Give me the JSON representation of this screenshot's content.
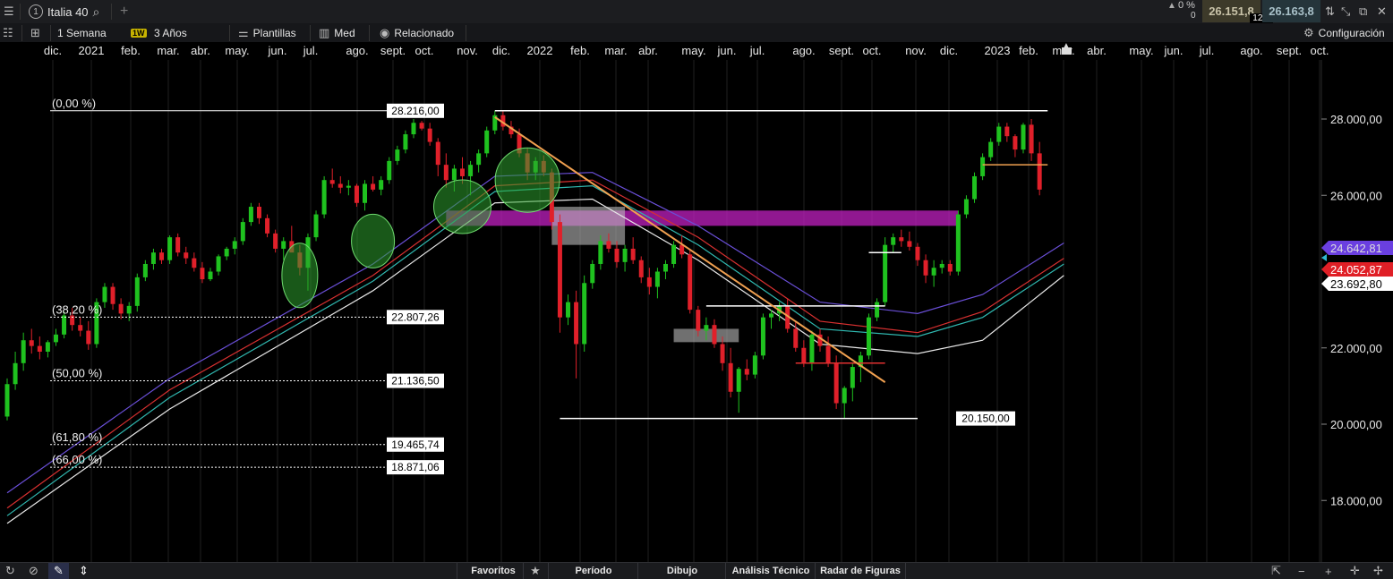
{
  "toolbar": {
    "instrument": "Italia 40",
    "change_pct": "0 %",
    "change_count": "0",
    "bid": "26.151,8",
    "spread": "12,0",
    "ask": "26.163,8"
  },
  "chart_toolbar": {
    "interval": "1 Semana",
    "interval_badge": "1W",
    "range": "3 Años",
    "templates": "Plantillas",
    "average": "Med",
    "related": "Relacionado",
    "settings": "Configuración"
  },
  "months": [
    "dic.",
    "2021",
    "feb.",
    "mar.",
    "abr.",
    "may.",
    "jun.",
    "jul.",
    "ago.",
    "sept.",
    "oct.",
    "nov.",
    "dic.",
    "2022",
    "feb.",
    "mar.",
    "abr.",
    "may.",
    "jun.",
    "jul.",
    "ago.",
    "sept.",
    "oct.",
    "nov.",
    "dic.",
    "2023",
    "feb.",
    "mar.",
    "abr.",
    "may.",
    "jun.",
    "jul.",
    "ago.",
    "sept.",
    "oct."
  ],
  "price_axis": [
    "28.000,00",
    "26.000,00",
    "22.000,00",
    "20.000,00",
    "18.000,00"
  ],
  "price_tags": {
    "purple": "24.642,81",
    "red": "24.052,87",
    "white": "23.692,80"
  },
  "fib_levels": [
    {
      "pct": "(0,00 %)",
      "value": "28.216,00"
    },
    {
      "pct": "(38,20 %)",
      "value": "22.807,26"
    },
    {
      "pct": "(50,00 %)",
      "value": "21.136,50"
    },
    {
      "pct": "(61,80 %)",
      "value": "19.465,74"
    },
    {
      "pct": "(66,00 %)",
      "value": "18.871,06"
    }
  ],
  "low_label": "20.150,00",
  "bottom_tabs": {
    "favorites": "Favoritos",
    "period": "Período",
    "drawing": "Dibujo",
    "technical": "Análisis Técnico",
    "patterns": "Radar de Figuras"
  },
  "colors": {
    "up": "#1fc21f",
    "down": "#e0202a",
    "fib_line": "#ffffff",
    "trendline": "#f0a050",
    "zone": "#c020c0",
    "ma_purple": "#6a4fd8",
    "ma_red": "#d83030",
    "ma_teal": "#2fb8b0",
    "ma_white": "#e8e8e8"
  },
  "chart_data": {
    "type": "candlestick",
    "title": "Italia 40",
    "interval": "1 Semana",
    "range": "3 Años",
    "ylim": [
      16500,
      29800
    ],
    "y_ticks": [
      28000,
      26000,
      22000,
      20000,
      18000
    ],
    "candles": [
      [
        20200,
        21200,
        20100,
        21050
      ],
      [
        21050,
        21900,
        20900,
        21600
      ],
      [
        21600,
        22400,
        21400,
        22200
      ],
      [
        22200,
        22500,
        21850,
        22050
      ],
      [
        22050,
        22300,
        21700,
        21900
      ],
      [
        21900,
        22200,
        21750,
        22150
      ],
      [
        22150,
        22500,
        22050,
        22350
      ],
      [
        22350,
        22950,
        22250,
        22850
      ],
      [
        22850,
        23050,
        22450,
        22600
      ],
      [
        22600,
        22800,
        22300,
        22450
      ],
      [
        22450,
        22700,
        21950,
        22100
      ],
      [
        22100,
        23300,
        22000,
        23200
      ],
      [
        23200,
        23700,
        23050,
        23600
      ],
      [
        23600,
        23700,
        23000,
        23150
      ],
      [
        23150,
        23300,
        22750,
        22900
      ],
      [
        22900,
        23200,
        22700,
        23100
      ],
      [
        23100,
        23950,
        22950,
        23850
      ],
      [
        23850,
        24300,
        23750,
        24200
      ],
      [
        24200,
        24600,
        24050,
        24500
      ],
      [
        24500,
        24600,
        24200,
        24300
      ],
      [
        24300,
        24950,
        24200,
        24900
      ],
      [
        24900,
        25000,
        24400,
        24500
      ],
      [
        24500,
        24650,
        24200,
        24350
      ],
      [
        24350,
        24500,
        24000,
        24100
      ],
      [
        24100,
        24250,
        23700,
        23800
      ],
      [
        23800,
        24100,
        23750,
        24000
      ],
      [
        24000,
        24450,
        23900,
        24400
      ],
      [
        24400,
        24650,
        24300,
        24600
      ],
      [
        24600,
        24900,
        24450,
        24800
      ],
      [
        24800,
        25400,
        24700,
        25300
      ],
      [
        25300,
        25800,
        25200,
        25700
      ],
      [
        25700,
        25800,
        25250,
        25400
      ],
      [
        25400,
        25500,
        24900,
        25000
      ],
      [
        25000,
        25100,
        24500,
        24600
      ],
      [
        24600,
        24900,
        24300,
        24800
      ],
      [
        24800,
        25200,
        24600,
        24500
      ],
      [
        24500,
        24700,
        23900,
        24100
      ],
      [
        24100,
        25000,
        23500,
        24900
      ],
      [
        24900,
        25600,
        24800,
        25500
      ],
      [
        25500,
        26500,
        25400,
        26400
      ],
      [
        26400,
        26700,
        26200,
        26300
      ],
      [
        26300,
        26500,
        26050,
        26200
      ],
      [
        26200,
        26400,
        26000,
        26250
      ],
      [
        26250,
        26300,
        25700,
        25800
      ],
      [
        25800,
        26400,
        25600,
        26300
      ],
      [
        26300,
        26500,
        26100,
        26150
      ],
      [
        26150,
        26500,
        26000,
        26400
      ],
      [
        26400,
        27000,
        26300,
        26900
      ],
      [
        26900,
        27300,
        26800,
        27200
      ],
      [
        27200,
        27700,
        27100,
        27600
      ],
      [
        27600,
        28000,
        27500,
        27900
      ],
      [
        27900,
        27950,
        27700,
        27750
      ],
      [
        27750,
        27900,
        27300,
        27400
      ],
      [
        27400,
        27500,
        26500,
        26800
      ],
      [
        26800,
        27100,
        26200,
        26400
      ],
      [
        26400,
        26800,
        26100,
        26700
      ],
      [
        26700,
        27000,
        26300,
        26500
      ],
      [
        26500,
        26900,
        26000,
        26800
      ],
      [
        26800,
        27200,
        26600,
        27100
      ],
      [
        27100,
        27800,
        27000,
        27700
      ],
      [
        27700,
        28216,
        27600,
        28100
      ],
      [
        28100,
        28200,
        27700,
        27800
      ],
      [
        27800,
        27950,
        27500,
        27600
      ],
      [
        27600,
        27750,
        27000,
        27100
      ],
      [
        27100,
        27250,
        26400,
        26600
      ],
      [
        26600,
        27000,
        26400,
        26900
      ],
      [
        26900,
        27050,
        26500,
        26600
      ],
      [
        26600,
        26700,
        25100,
        25300
      ],
      [
        25300,
        25500,
        22400,
        22800
      ],
      [
        22800,
        23400,
        22600,
        23200
      ],
      [
        23200,
        23500,
        21200,
        22100
      ],
      [
        22100,
        23900,
        21900,
        23700
      ],
      [
        23700,
        24300,
        23550,
        24200
      ],
      [
        24200,
        24950,
        24050,
        24800
      ],
      [
        24800,
        25000,
        24500,
        24600
      ],
      [
        24600,
        24800,
        24100,
        24250
      ],
      [
        24250,
        24700,
        24000,
        24600
      ],
      [
        24600,
        24900,
        24200,
        24300
      ],
      [
        24300,
        24400,
        23700,
        23850
      ],
      [
        23850,
        24100,
        23400,
        23600
      ],
      [
        23600,
        24100,
        23300,
        24000
      ],
      [
        24000,
        24300,
        23800,
        24200
      ],
      [
        24200,
        24800,
        24100,
        24700
      ],
      [
        24700,
        24950,
        24350,
        24450
      ],
      [
        24450,
        24550,
        22900,
        23000
      ],
      [
        23000,
        23100,
        22300,
        22450
      ],
      [
        22450,
        22800,
        22200,
        22600
      ],
      [
        22600,
        22750,
        22000,
        22100
      ],
      [
        22100,
        22300,
        21400,
        21600
      ],
      [
        21600,
        22000,
        20700,
        20850
      ],
      [
        20850,
        21500,
        20300,
        21450
      ],
      [
        21450,
        21700,
        21150,
        21300
      ],
      [
        21300,
        21900,
        21200,
        21800
      ],
      [
        21800,
        22900,
        21700,
        22800
      ],
      [
        22800,
        23000,
        22500,
        22900
      ],
      [
        22900,
        23200,
        22700,
        23100
      ],
      [
        23100,
        23300,
        22400,
        22500
      ],
      [
        22500,
        22700,
        21900,
        22000
      ],
      [
        22000,
        22200,
        21500,
        21600
      ],
      [
        21600,
        22450,
        21400,
        22350
      ],
      [
        22350,
        22500,
        21900,
        22050
      ],
      [
        22050,
        22300,
        21500,
        21600
      ],
      [
        21600,
        21800,
        20400,
        20550
      ],
      [
        20550,
        21000,
        20150,
        20950
      ],
      [
        20950,
        21600,
        20600,
        21500
      ],
      [
        21500,
        21900,
        21100,
        21800
      ],
      [
        21800,
        22900,
        21700,
        22800
      ],
      [
        22800,
        23300,
        22700,
        23200
      ],
      [
        23200,
        24900,
        23100,
        24700
      ],
      [
        24700,
        25000,
        24500,
        24900
      ],
      [
        24900,
        25100,
        24650,
        24800
      ],
      [
        24800,
        25050,
        24550,
        24650
      ],
      [
        24650,
        24750,
        24150,
        24300
      ],
      [
        24300,
        24450,
        23700,
        23900
      ],
      [
        23900,
        24300,
        23600,
        24100
      ],
      [
        24100,
        24300,
        23950,
        24200
      ],
      [
        24200,
        24300,
        23900,
        24000
      ],
      [
        24000,
        25600,
        23900,
        25500
      ],
      [
        25500,
        26000,
        25400,
        25900
      ],
      [
        25900,
        26600,
        25800,
        26500
      ],
      [
        26500,
        27100,
        26400,
        27000
      ],
      [
        27000,
        27500,
        26900,
        27400
      ],
      [
        27400,
        27900,
        27300,
        27800
      ],
      [
        27800,
        27900,
        27400,
        27550
      ],
      [
        27550,
        27600,
        27000,
        27200
      ],
      [
        27200,
        27900,
        27100,
        27850
      ],
      [
        27850,
        28000,
        26900,
        27100
      ],
      [
        27100,
        27400,
        26000,
        26150
      ]
    ],
    "moving_averages": [
      {
        "color": "#6a4fd8",
        "values": [
          [
            0,
            18200
          ],
          [
            20,
            21200
          ],
          [
            45,
            24200
          ],
          [
            60,
            26500
          ],
          [
            72,
            26600
          ],
          [
            85,
            25200
          ],
          [
            100,
            23200
          ],
          [
            112,
            22900
          ],
          [
            120,
            23400
          ],
          [
            130,
            24750
          ]
        ]
      },
      {
        "color": "#d83030",
        "values": [
          [
            0,
            17800
          ],
          [
            20,
            20900
          ],
          [
            45,
            23900
          ],
          [
            60,
            26250
          ],
          [
            72,
            26400
          ],
          [
            85,
            24900
          ],
          [
            100,
            22700
          ],
          [
            112,
            22400
          ],
          [
            120,
            22950
          ],
          [
            130,
            24350
          ]
        ]
      },
      {
        "color": "#2fb8b0",
        "values": [
          [
            0,
            17600
          ],
          [
            20,
            20700
          ],
          [
            45,
            23750
          ],
          [
            60,
            26100
          ],
          [
            72,
            26250
          ],
          [
            85,
            24700
          ],
          [
            100,
            22500
          ],
          [
            112,
            22300
          ],
          [
            120,
            22800
          ],
          [
            130,
            24200
          ]
        ]
      },
      {
        "color": "#e8e8e8",
        "values": [
          [
            0,
            17400
          ],
          [
            20,
            20400
          ],
          [
            45,
            23500
          ],
          [
            60,
            25800
          ],
          [
            72,
            25900
          ],
          [
            85,
            24300
          ],
          [
            100,
            22100
          ],
          [
            112,
            21850
          ],
          [
            120,
            22200
          ],
          [
            130,
            23900
          ]
        ]
      }
    ],
    "fibonacci": [
      {
        "level": 0.0,
        "price": 28216.0
      },
      {
        "level": 38.2,
        "price": 22807.26
      },
      {
        "level": 50.0,
        "price": 21136.5
      },
      {
        "level": 61.8,
        "price": 19465.74
      },
      {
        "level": 66.0,
        "price": 18871.06
      }
    ],
    "horizontal_lines": [
      {
        "price": 28216,
        "from": 60,
        "to": 128
      },
      {
        "price": 20150,
        "from": 68,
        "to": 112
      },
      {
        "price": 23100,
        "from": 86,
        "to": 108
      },
      {
        "price": 24500,
        "from": 106,
        "to": 110
      },
      {
        "price": 21600,
        "from": 97,
        "to": 108
      },
      {
        "price": 26800,
        "from": 120,
        "to": 128
      }
    ],
    "trendline": {
      "from": [
        60,
        28050
      ],
      "to": [
        108,
        21100
      ]
    },
    "zones": [
      {
        "from": 54,
        "to": 117,
        "low": 25200,
        "high": 25600,
        "color": "#c020c0"
      },
      {
        "from": 67,
        "to": 76,
        "low": 24700,
        "high": 25700,
        "color": "#bbbbbb"
      },
      {
        "from": 82,
        "to": 90,
        "low": 22150,
        "high": 22500,
        "color": "#bbbbbb"
      }
    ],
    "ellipses": [
      {
        "x": 36,
        "price": 23900
      },
      {
        "x": 45,
        "price": 24800
      },
      {
        "x": 56,
        "price": 25700
      },
      {
        "x": 64,
        "price": 26400
      }
    ]
  }
}
